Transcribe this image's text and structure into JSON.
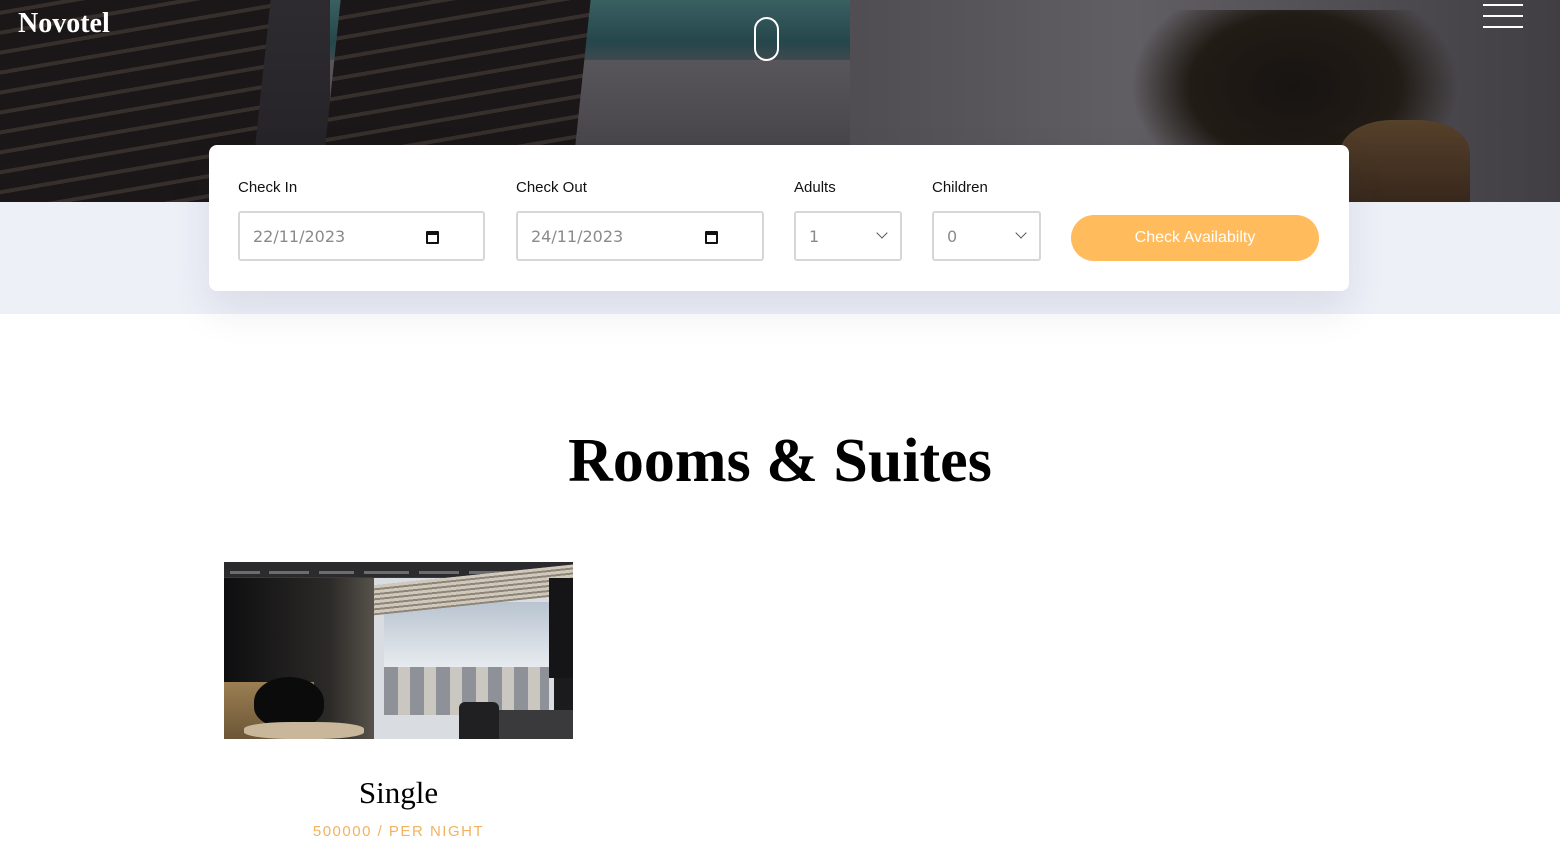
{
  "header": {
    "logo": "Novotel"
  },
  "booking": {
    "check_in": {
      "label": "Check In",
      "value": "22/11/2023"
    },
    "check_out": {
      "label": "Check Out",
      "value": "24/11/2023"
    },
    "adults": {
      "label": "Adults",
      "value": "1"
    },
    "children": {
      "label": "Children",
      "value": "0"
    },
    "submit_label": "Check Availabilty"
  },
  "rooms": {
    "title": "Rooms & Suites",
    "items": [
      {
        "name": "Single",
        "price": "500000 / PER NIGHT"
      }
    ]
  },
  "colors": {
    "accent": "#ffbb5c",
    "price": "#f2b25f",
    "strip": "#eef0f8"
  },
  "icons": [
    "menu-icon",
    "scroll-indicator-icon",
    "calendar-icon",
    "chevron-down-icon"
  ]
}
